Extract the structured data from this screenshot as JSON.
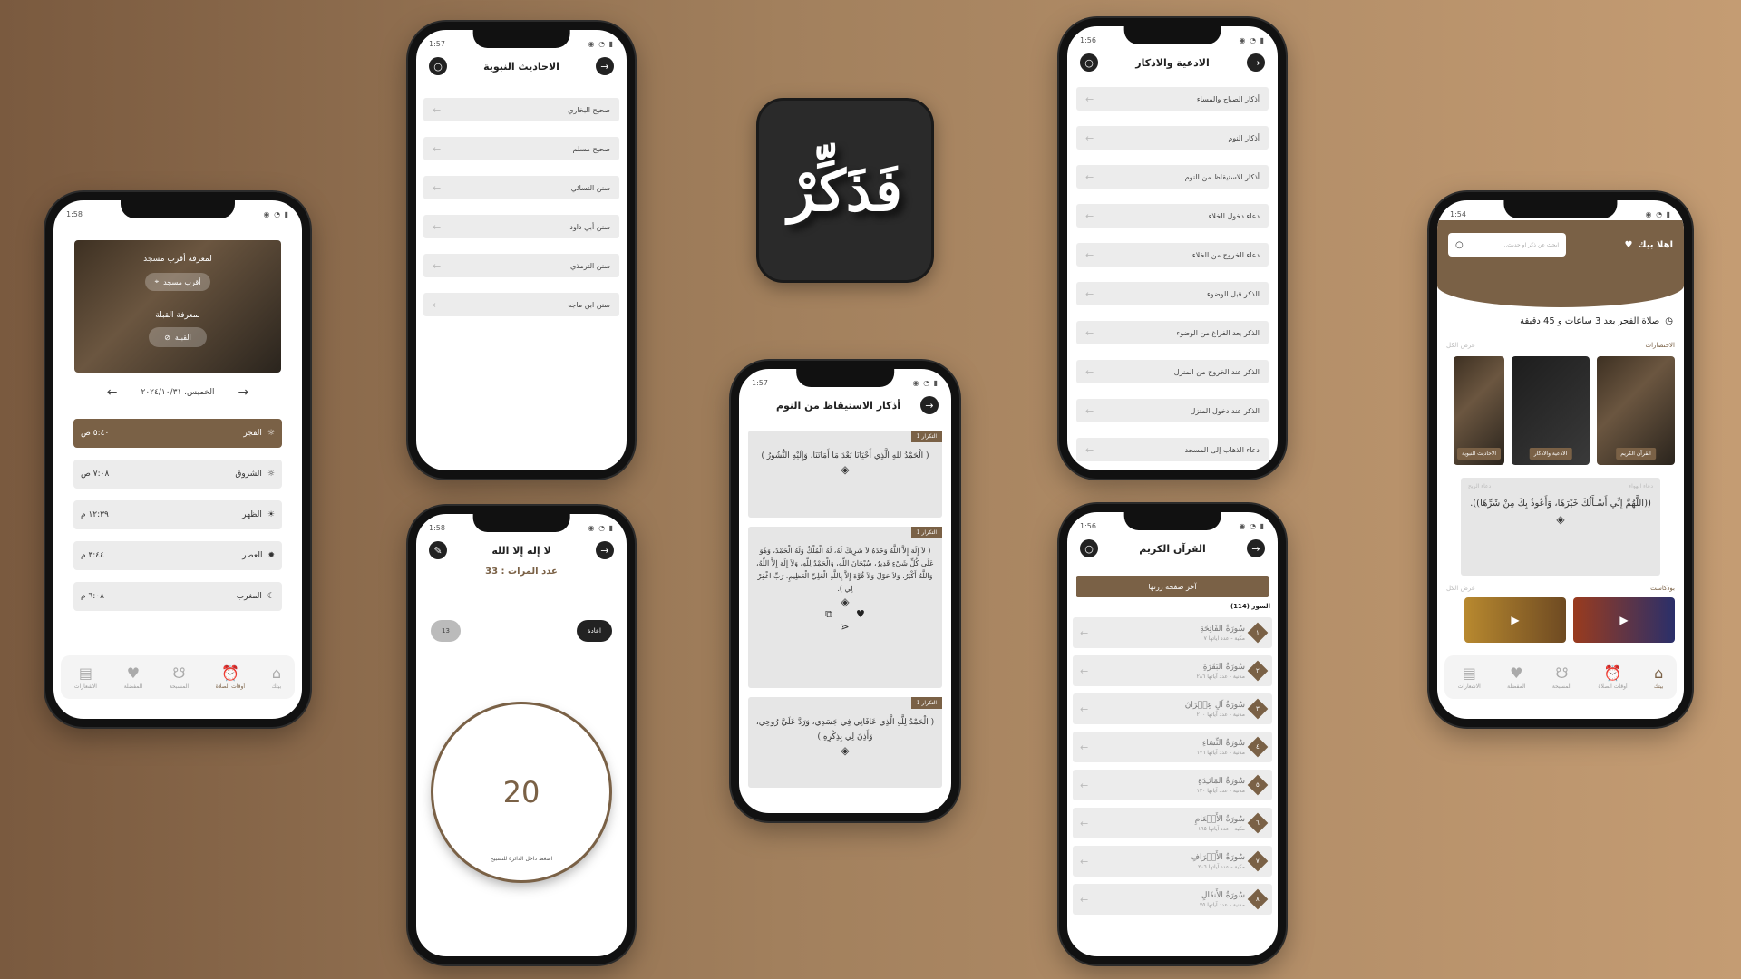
{
  "logo": {
    "text": "فَذَكِّرْ"
  },
  "p1": {
    "time": "1:58",
    "mosque_title": "لمعرفة أقرب مسجد",
    "mosque_btn": "أقرب مسجد",
    "qibla_title": "لمعرفة القبلة",
    "qibla_btn": "القبلة",
    "date": "الخميس، ٢٠٢٤/١٠/٣١",
    "prayers": [
      {
        "name": "الفجر",
        "time": "٥:٤٠ ص"
      },
      {
        "name": "الشروق",
        "time": "٧:٠٨ ص"
      },
      {
        "name": "الظهر",
        "time": "١٢:٣٩ م"
      },
      {
        "name": "العصر",
        "time": "٣:٤٤ م"
      },
      {
        "name": "المغرب",
        "time": "٦:٠٨ م"
      }
    ],
    "nav": [
      "بيتك",
      "أوقات الصلاة",
      "المسبحة",
      "المفضلة",
      "الاشعارات"
    ]
  },
  "p2": {
    "time": "1:57",
    "title": "الاحاديث النبوية",
    "items": [
      "صحيح البخاري",
      "صحيح مسلم",
      "سنن النسائي",
      "سنن أبي داود",
      "سنن الترمذي",
      "سنن ابن ماجه"
    ]
  },
  "p3": {
    "time": "1:58",
    "title": "لا إله إلا الله",
    "count_label": "عدد المرات : 33",
    "reset": "اعادة",
    "pill": "13",
    "counter": "20",
    "hint": "اضغط داخل الدائرة للتسبيح"
  },
  "p4": {
    "time": "1:57",
    "title": "أذكار الاستيقاظ من النوم",
    "cards": [
      {
        "tag": "التكرار 1",
        "text": "( الْحَمْدُ للهِ الَّذِي أَحْيَانَا بَعْدَ مَا أَمَاتَنَا، وَإِلَيْهِ النُّشُورُ )"
      },
      {
        "tag": "التكرار 1",
        "text": "( لاَ إِلَهَ إِلاَّ اللَّهُ وَحْدَهُ لاَ شَرِيكَ لَهُ، لَهُ الْمُلْكُ وَلَهُ الْحَمْدُ، وَهُوَ عَلَى كُلِّ شَيْءٍ قَدِيرٌ، سُبْحَانَ اللَّهِ، وَالْحَمْدُ لِلَّهِ، وَلاَ إِلَهَ إِلاَّ اللَّهُ، وَاللَّهُ أَكْبَرُ، وَلاَ حَوْلَ وَلاَ قُوَّةَ إِلاَّ بِاللَّهِ الْعَلِيِّ الْعَظِيمِ، رَبِّ اغْفِرْ لِي )."
      },
      {
        "tag": "التكرار 1",
        "text": "( الْحَمْدُ لِلَّهِ الَّذِي عَافَانِي فِي جَسَدِي، وَرَدَّ عَلَيَّ رُوحِي، وَأَذِنَ لِي بِذِكْرِهِ )"
      }
    ]
  },
  "p5": {
    "time": "1:56",
    "title": "الادعية والاذكار",
    "items": [
      "أذكار الصباح والمساء",
      "أذكار النوم",
      "أذكار الاستيقاظ من النوم",
      "دعاء دخول الخلاء",
      "دعاء الخروج من الخلاء",
      "الذكر قبل الوضوء",
      "الذكر بعد الفراغ من الوضوء",
      "الذكر عند الخروج من المنزل",
      "الذكر عند دخول المنزل",
      "دعاء الذهاب إلى المسجد"
    ]
  },
  "p6": {
    "time": "1:56",
    "title": "القرآن الكريم",
    "last_btn": "آخر صفحة زرتها",
    "count": "السور (114)",
    "surahs": [
      {
        "n": "١",
        "name": "سُورَةُ الفَاتِحَةِ",
        "info": "مكية - عدد آياتها ٧"
      },
      {
        "n": "٢",
        "name": "سُورَةُ البَقَرَةِ",
        "info": "مدنية - عدد آياتها ٢٨٦"
      },
      {
        "n": "٣",
        "name": "سُورَةُ آلِ عِمۡرَانَ",
        "info": "مدنية - عدد آياتها ٢٠٠"
      },
      {
        "n": "٤",
        "name": "سُورَةُ النِّسَاءِ",
        "info": "مدنية - عدد آياتها ١٧٦"
      },
      {
        "n": "٥",
        "name": "سُورَةُ المَائـِدَةِ",
        "info": "مدنية - عدد آياتها ١٢٠"
      },
      {
        "n": "٦",
        "name": "سُورَةُ الأَنۡعَامِ",
        "info": "مكية - عدد آياتها ١٦٥"
      },
      {
        "n": "٧",
        "name": "سُورَةُ الأَعۡرَافِ",
        "info": "مكية - عدد آياتها ٢٠٦"
      },
      {
        "n": "٨",
        "name": "سُورَةُ الأَنفَالِ",
        "info": "مدنية - عدد آياتها ٧٥"
      }
    ]
  },
  "p7": {
    "time": "1:54",
    "greet": "اهلا بيك",
    "search_ph": "ابحث عن ذكر او حديث...",
    "next_prayer": "صلاة الفجر بعد 3 ساعات و 45 دقيقة",
    "shortcuts": "الاختصارات",
    "see_all": "عرض الكل",
    "tiles": [
      "القرآن الكريم",
      "الادعية والاذكار",
      "الاحاديث النبوية"
    ],
    "dua_cat": "دعاء الريح",
    "dua_src": "دعاء الهواء",
    "dua_text": "((اللَّهُمَّ إِنِّي أَسْـأَلُكَ خَيْرَهَا، وَأَعُوذُ بِكَ مِنْ شَرِّهَا)).",
    "podcast": "بودكاست",
    "nav": [
      "بيتك",
      "أوقات الصلاة",
      "المسبحة",
      "المفضلة",
      "الاشعارات"
    ]
  }
}
